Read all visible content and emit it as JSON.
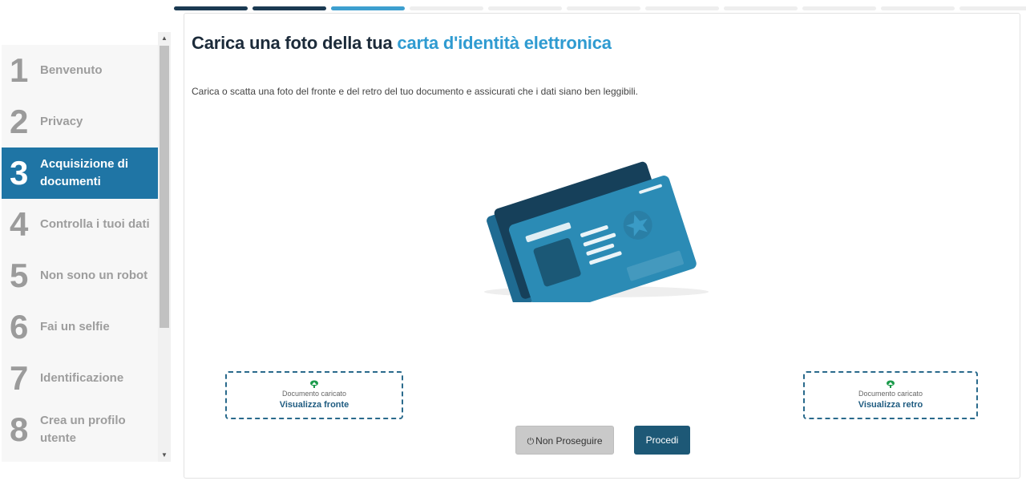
{
  "progress": {
    "total": 11,
    "done": 2,
    "active": 1
  },
  "sidebar": {
    "steps": [
      {
        "num": "1",
        "label": "Benvenuto"
      },
      {
        "num": "2",
        "label": "Privacy"
      },
      {
        "num": "3",
        "label": "Acquisizione di documenti"
      },
      {
        "num": "4",
        "label": "Controlla i tuoi dati"
      },
      {
        "num": "5",
        "label": "Non sono un robot"
      },
      {
        "num": "6",
        "label": "Fai un selfie"
      },
      {
        "num": "7",
        "label": "Identificazione"
      },
      {
        "num": "8",
        "label": "Crea un profilo utente"
      }
    ]
  },
  "main": {
    "title_prefix": "Carica una foto della tua",
    "title_highlight": "carta d'identità elettronica",
    "description": "Carica o scatta una foto del fronte e del retro del tuo documento e assicurati che i dati siano ben leggibili.",
    "upload_front": {
      "status": "Documento caricato",
      "link": "Visualizza fronte"
    },
    "upload_back": {
      "status": "Documento caricato",
      "link": "Visualizza retro"
    },
    "buttons": {
      "stop": "Non Proseguire",
      "proceed": "Procedi"
    }
  },
  "colors": {
    "progress_done": "#1b3a52",
    "progress_active": "#3d9fcf",
    "active_step": "#1f75a5",
    "title_highlight": "#2f9bd1",
    "primary_button": "#1d5876",
    "upload_icon": "#1a9a4a"
  }
}
